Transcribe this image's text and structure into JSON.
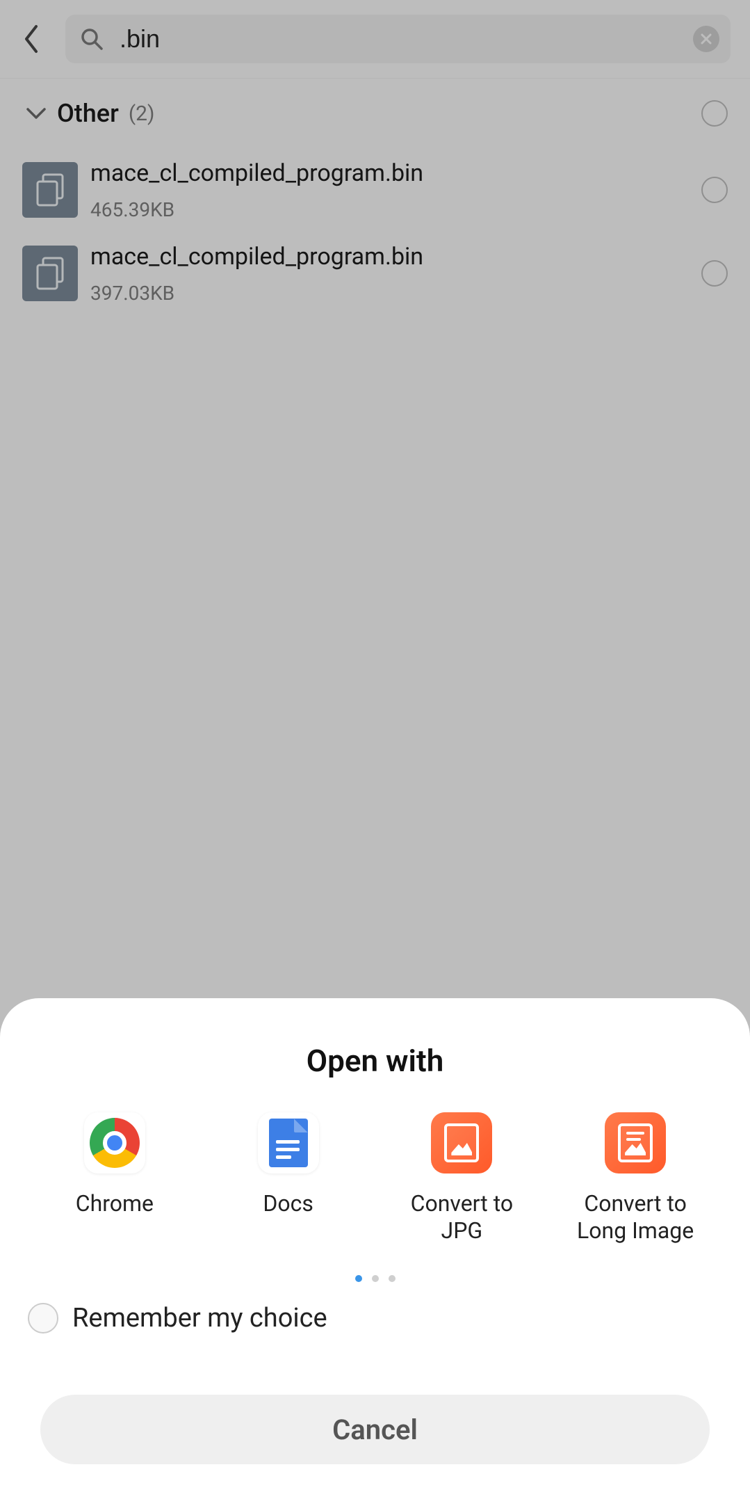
{
  "search": {
    "value": ".bin"
  },
  "category": {
    "label": "Other",
    "count": "(2)"
  },
  "files": [
    {
      "name": "mace_cl_compiled_program.bin",
      "size": "465.39KB"
    },
    {
      "name": "mace_cl_compiled_program.bin",
      "size": "397.03KB"
    }
  ],
  "sheet": {
    "title": "Open with",
    "apps": [
      {
        "label": "Chrome"
      },
      {
        "label": "Docs"
      },
      {
        "label": "Convert to JPG"
      },
      {
        "label": "Convert to Long Image"
      }
    ],
    "remember_label": "Remember my choice",
    "cancel_label": "Cancel"
  }
}
